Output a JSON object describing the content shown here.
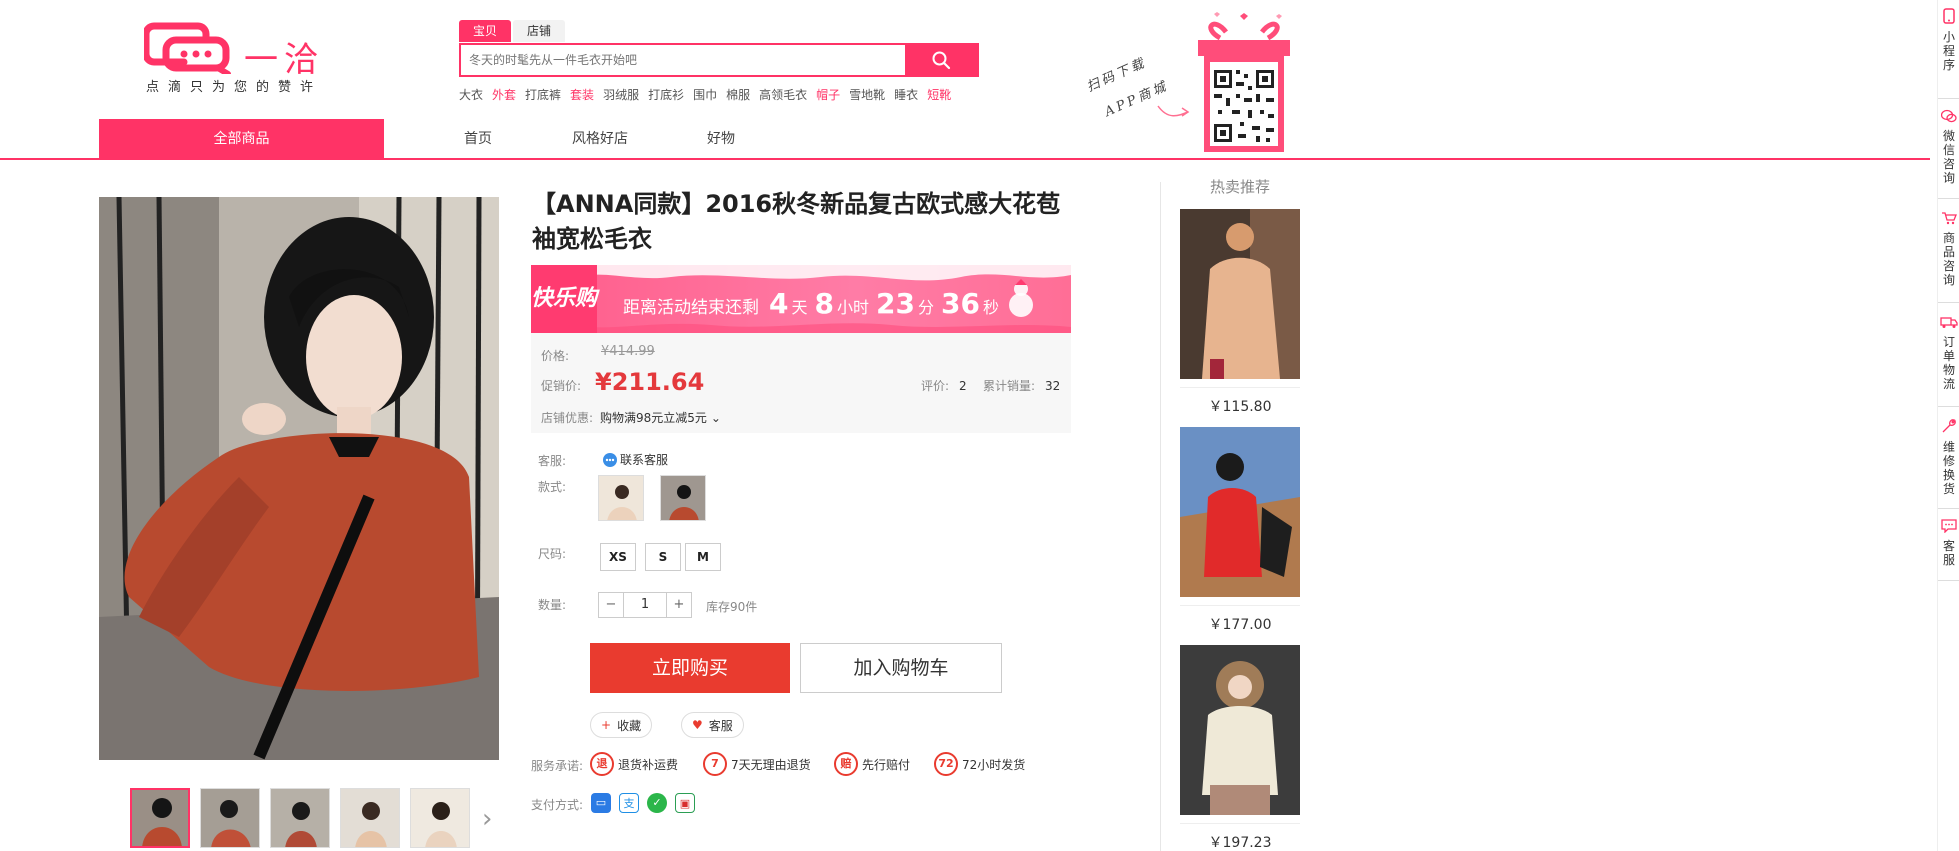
{
  "brand": {
    "name": "一洽",
    "slogan": "点滴只为您的赞许"
  },
  "search": {
    "tabs": [
      "宝贝",
      "店铺"
    ],
    "placeholder": "冬天的时髦先从一件毛衣开始吧"
  },
  "hotwords": [
    {
      "text": "大衣",
      "hot": false
    },
    {
      "text": "外套",
      "hot": true
    },
    {
      "text": "打底裤",
      "hot": false
    },
    {
      "text": "套装",
      "hot": true
    },
    {
      "text": "羽绒服",
      "hot": false
    },
    {
      "text": "打底衫",
      "hot": false
    },
    {
      "text": "围巾",
      "hot": false
    },
    {
      "text": "棉服",
      "hot": false
    },
    {
      "text": "高领毛衣",
      "hot": false
    },
    {
      "text": "帽子",
      "hot": true
    },
    {
      "text": "雪地靴",
      "hot": false
    },
    {
      "text": "睡衣",
      "hot": false
    },
    {
      "text": "短靴",
      "hot": true
    }
  ],
  "app_download": {
    "line1": "扫码下载",
    "line2": "APP商城"
  },
  "nav": {
    "all": "全部商品",
    "items": [
      "首页",
      "风格好店",
      "好物"
    ]
  },
  "product": {
    "title": "【ANNA同款】2016秋冬新品复古欧式感大花苞袖宽松毛衣",
    "promo": {
      "logo": "快乐购",
      "prefix": "距离活动结束还剩",
      "days": "4",
      "days_unit": "天",
      "hours": "8",
      "hours_unit": "小时",
      "minutes": "23",
      "minutes_unit": "分",
      "seconds": "36",
      "seconds_unit": "秒"
    },
    "price_label": "价格:",
    "original_price": "¥414.99",
    "sale_label": "促销价:",
    "sale_price": "¥211.64",
    "reviews_label": "评价:",
    "reviews": "2",
    "sales_label": "累计销量:",
    "sales": "32",
    "coupon_label": "店铺优惠:",
    "coupon": "购物满98元立减5元",
    "service_label": "客服:",
    "service_link": "联系客服",
    "style_label": "款式:",
    "size_label": "尺码:",
    "sizes": [
      "XS",
      "S",
      "M"
    ],
    "qty_label": "数量:",
    "qty": "1",
    "stock": "库存90件",
    "buy_now": "立即购买",
    "add_cart": "加入购物车",
    "favorite": "收藏",
    "customer_service": "客服",
    "promise_label": "服务承诺:",
    "promises": [
      {
        "icon": "退",
        "text": "退货补运费"
      },
      {
        "icon": "7",
        "text": "7天无理由退货"
      },
      {
        "icon": "赔",
        "text": "先行赔付"
      },
      {
        "icon": "72",
        "text": "72小时发货"
      }
    ],
    "payment_label": "支付方式:"
  },
  "recommend": {
    "title": "热卖推荐",
    "items": [
      {
        "price": "￥115.80"
      },
      {
        "price": "￥177.00"
      },
      {
        "price": "￥197.23"
      }
    ]
  },
  "sidebar": [
    {
      "label": "小程序",
      "icon": "phone-icon"
    },
    {
      "label": "微信咨询",
      "icon": "wechat-icon"
    },
    {
      "label": "商品咨询",
      "icon": "cart-icon"
    },
    {
      "label": "订单物流",
      "icon": "truck-icon"
    },
    {
      "label": "维修换货",
      "icon": "wrench-icon"
    },
    {
      "label": "客服",
      "icon": "chat-icon"
    }
  ],
  "colors": {
    "accent": "#ff3366",
    "buy": "#e93b2f",
    "price": "#e4393c"
  }
}
